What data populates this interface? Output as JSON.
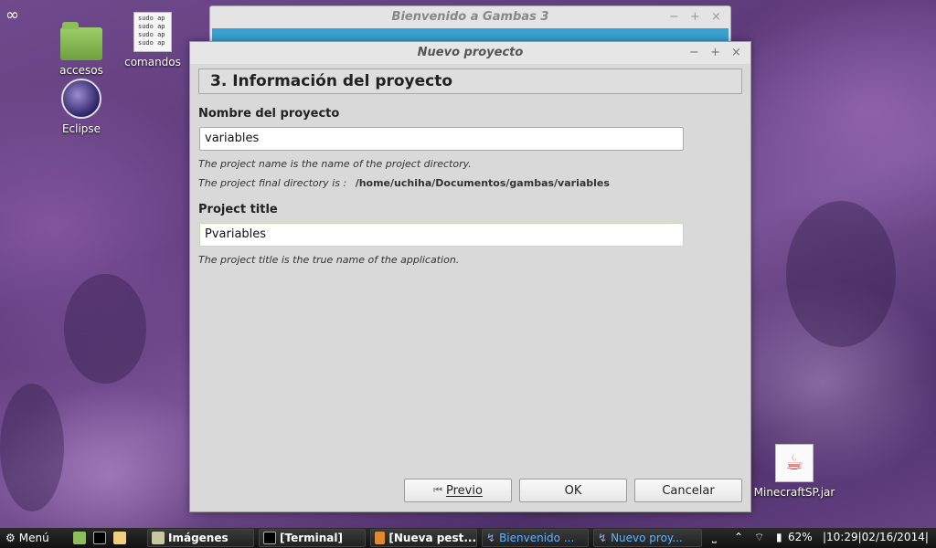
{
  "desktop": {
    "icons": [
      {
        "label": "accesos"
      },
      {
        "label": "comandos",
        "preview": "sudo ap\nsudo ap\nsudo ap\nsudo ap"
      },
      {
        "label": "Eclipse"
      },
      {
        "label": "MinecraftSP.jar"
      }
    ]
  },
  "background_window": {
    "title": "Bienvenido a Gambas 3",
    "controls": [
      "−",
      "+",
      "×"
    ]
  },
  "dialog": {
    "title": "Nuevo proyecto",
    "controls": [
      "−",
      "+",
      "×"
    ],
    "step_header": "3. Información del proyecto",
    "project_name": {
      "label": "Nombre del proyecto",
      "value": "variables",
      "hint": "The project name is the name of the project directory.",
      "dir_hint": "The project final directory is :",
      "dir_path": "/home/uchiha/Documentos/gambas/variables"
    },
    "project_title": {
      "label": "Project title",
      "value": "Pvariables",
      "hint": "The project title is the true name of the application."
    },
    "buttons": {
      "prev": "Previo",
      "ok": "OK",
      "cancel": "Cancelar"
    }
  },
  "taskbar": {
    "menu_label": "Menú",
    "tasks": [
      {
        "label": "Imágenes"
      },
      {
        "label": "[Terminal]"
      },
      {
        "label": "[Nueva pest..."
      },
      {
        "label": "Bienvenido ..."
      },
      {
        "label": "Nuevo proy..."
      }
    ],
    "battery": "62%",
    "clock": "|10:29|02/16/2014|"
  }
}
